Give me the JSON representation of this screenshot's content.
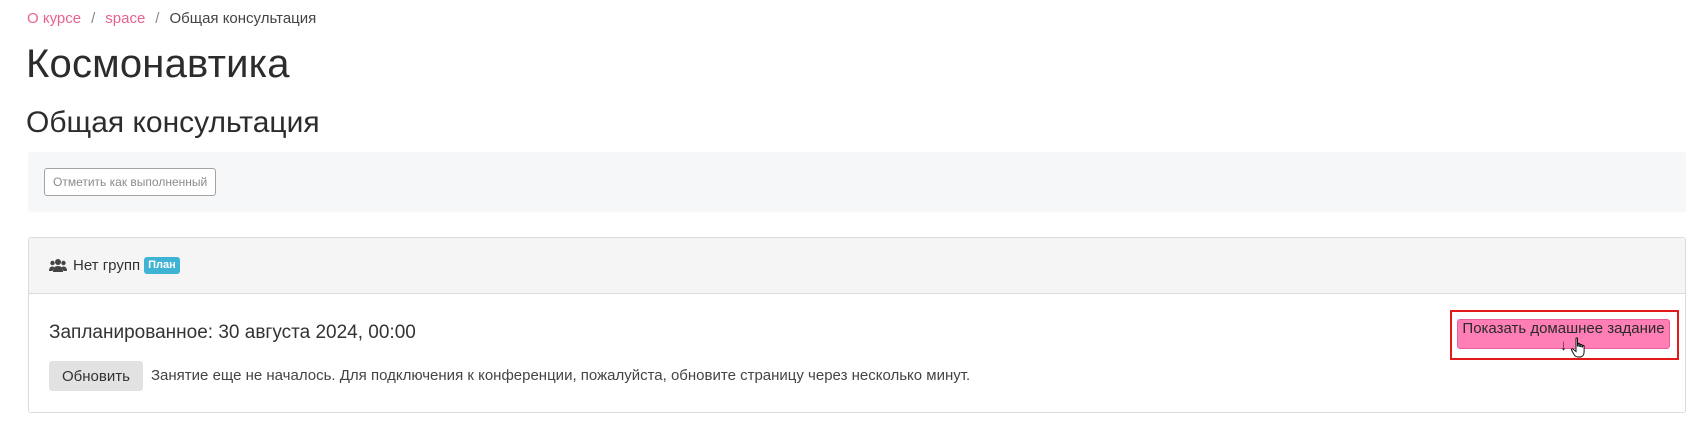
{
  "breadcrumb": {
    "items": [
      "О курсе",
      "space"
    ],
    "current": "Общая консультация",
    "separator": "/"
  },
  "course": {
    "title": "Космонавтика"
  },
  "lesson": {
    "title": "Общая консультация"
  },
  "completion": {
    "button_label": "Отметить как выполненный"
  },
  "group_card": {
    "header_label": "Нет групп",
    "badge": "План",
    "scheduled_text": "Запланированное: 30 августа 2024, 00:00",
    "refresh_label": "Обновить",
    "info_text": "Занятие еще не началось. Для подключения к конференции, пожалуйста, обновите страницу через несколько минут.",
    "homework_button_label": "Показать домашнее задание ↓"
  },
  "colors": {
    "link": "#e8628e",
    "homework_button": "#ff7eb6",
    "badge": "#3fb3d3",
    "highlight": "#e21a1a"
  },
  "icons": {
    "group": "users-icon",
    "cursor": "hand-cursor-icon"
  }
}
